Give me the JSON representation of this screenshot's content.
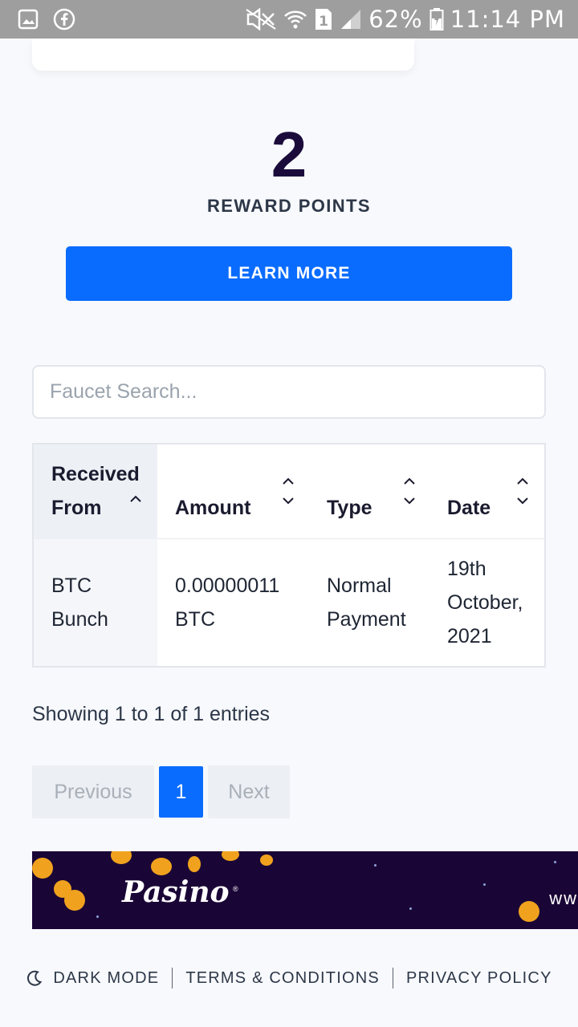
{
  "status_bar": {
    "battery": "62%",
    "time": "11:14 PM",
    "sim_slot": "1",
    "icons": [
      "gallery-icon",
      "facebook-icon",
      "mute-icon",
      "wifi-icon",
      "sim-icon",
      "signal-icon",
      "battery-charging-icon"
    ]
  },
  "rewards": {
    "points": "2",
    "label": "REWARD POINTS",
    "learn_more": "LEARN MORE"
  },
  "search": {
    "placeholder": "Faucet Search...",
    "value": ""
  },
  "table": {
    "columns": [
      "Received From",
      "Amount",
      "Type",
      "Date"
    ],
    "rows": [
      [
        "BTC Bunch",
        "0.00000011 BTC",
        "Normal Payment",
        "19th October, 2021"
      ]
    ]
  },
  "pagination": {
    "info": "Showing 1 to 1 of 1 entries",
    "previous": "Previous",
    "current": "1",
    "next": "Next"
  },
  "banner": {
    "brand": "Pasino",
    "trailing_text": "ww"
  },
  "footer": {
    "dark_mode": "DARK MODE",
    "terms": "TERMS & CONDITIONS",
    "privacy": "PRIVACY POLICY"
  },
  "colors": {
    "accent": "#0a6cff",
    "points": "#1b0b3b",
    "banner_bg": "#1a0636",
    "coin": "#f0a21e"
  }
}
